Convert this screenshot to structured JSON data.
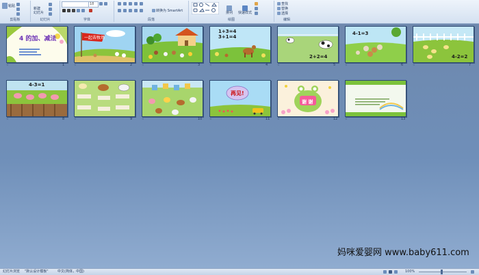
{
  "ribbon": {
    "paste_label": "粘贴",
    "slide_labels": [
      "新建",
      "幻灯片"
    ],
    "groups": [
      "剪贴板",
      "幻灯片",
      "字体",
      "段落",
      "绘图",
      "编辑"
    ],
    "font_size": "18",
    "smartart_label": "转换为 SmartArt",
    "arrange_label": "排列",
    "quickstyle_label": "快速样式",
    "edit_items": [
      "查找",
      "替换",
      "选择"
    ]
  },
  "slides": [
    {
      "number": "1",
      "title": "4 的加、减法"
    },
    {
      "number": "2",
      "title": "一起去牧场"
    },
    {
      "number": "3",
      "title": ""
    },
    {
      "number": "4",
      "eq1": "1+3=4",
      "eq2": "3+1=4"
    },
    {
      "number": "5",
      "eq": "2+2=4"
    },
    {
      "number": "6",
      "eq": "4-1=3"
    },
    {
      "number": "7",
      "eq": "4-2=2"
    },
    {
      "number": "8",
      "eq": "4-3=1"
    },
    {
      "number": "9",
      "title": ""
    },
    {
      "number": "10",
      "title": ""
    },
    {
      "number": "11",
      "title": "再见!"
    },
    {
      "number": "12",
      "title": "谢 谢"
    },
    {
      "number": "13",
      "title": ""
    }
  ],
  "statusbar": {
    "view": "幻灯片浏览",
    "theme": "\"默认设计模板\"",
    "language": "中文(简体，中国)",
    "zoom": "100%"
  },
  "watermark": "妈咪爱婴网 www.baby611.com"
}
